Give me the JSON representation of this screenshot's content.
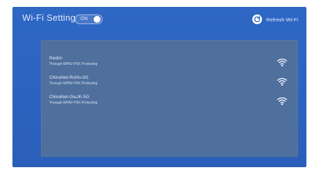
{
  "header": {
    "title": "Wi-Fi Setting",
    "toggle": {
      "label": "ON",
      "state": "on"
    },
    "refresh": {
      "icon": "refresh-icon",
      "label": "Refresh Wi-Fi"
    }
  },
  "networks": [
    {
      "name": "Redmi",
      "security": "Through WPA2-PSK Protecting",
      "icon": "wifi-signal-icon"
    },
    {
      "name": "ChinaNet-RoHo-5G",
      "security": "Through WPA2-PSK Protecting",
      "icon": "wifi-signal-icon"
    },
    {
      "name": "ChinaNet-GiuJK-5G",
      "security": "Through WPA2-PSK Protecting",
      "icon": "wifi-signal-icon"
    }
  ],
  "colors": {
    "background": "#2f67c4",
    "panel": "#4f6f9d",
    "text": "#e9f2ff"
  }
}
